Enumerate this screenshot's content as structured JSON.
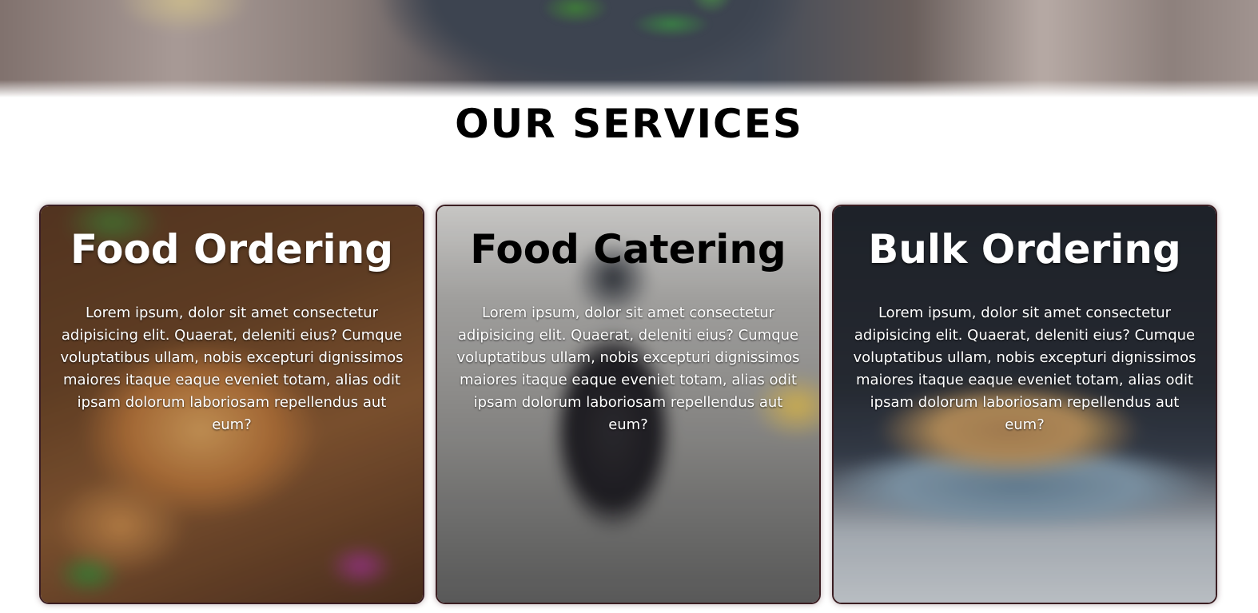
{
  "section": {
    "title": "OUR SERVICES"
  },
  "services": [
    {
      "title": "Food Ordering",
      "description": "Lorem ipsum, dolor sit amet consectetur adipisicing elit. Quaerat, deleniti eius? Cumque voluptatibus ullam, nobis excepturi dignissimos maiores itaque eaque eveniet totam, alias odit ipsam dolorum laboriosam repellendus aut eum?",
      "image": "pizza-photo"
    },
    {
      "title": "Food Catering",
      "description": "Lorem ipsum, dolor sit amet consectetur adipisicing elit. Quaerat, deleniti eius? Cumque voluptatibus ullam, nobis excepturi dignissimos maiores itaque eaque eveniet totam, alias odit ipsam dolorum laboriosam repellendus aut eum?",
      "image": "delivery-scooter-photo"
    },
    {
      "title": "Bulk Ordering",
      "description": "Lorem ipsum, dolor sit amet consectetur adipisicing elit. Quaerat, deleniti eius? Cumque voluptatibus ullam, nobis excepturi dignissimos maiores itaque eaque eveniet totam, alias odit ipsam dolorum laboriosam repellendus aut eum?",
      "image": "burger-plate-photo"
    }
  ],
  "colors": {
    "card_border": "#3b1e22",
    "title_text": "#000000",
    "card_text": "#ffffff"
  }
}
